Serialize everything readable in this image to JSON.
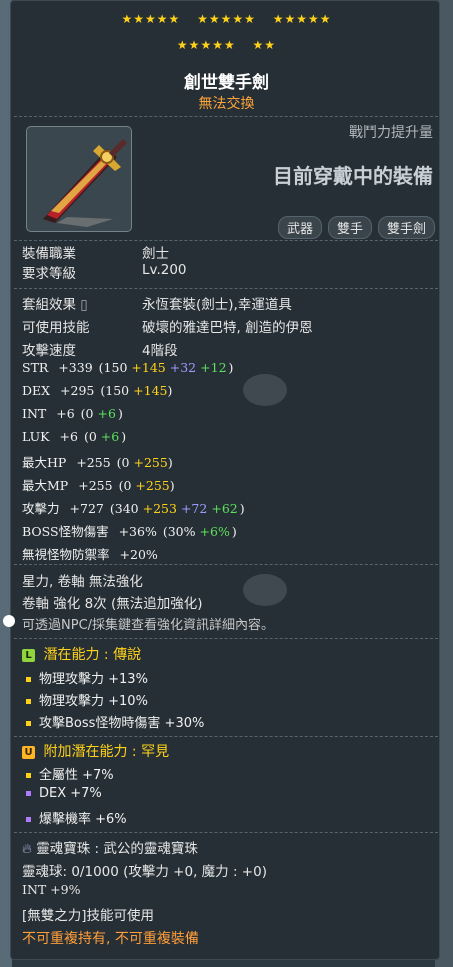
{
  "stars": {
    "row1": [
      "★★★★★",
      "★★★★★",
      "★★★★★"
    ],
    "row2": [
      "★★★★★",
      "★★"
    ]
  },
  "item": {
    "name": "創世雙手劍",
    "trade": "無法交換",
    "power_label": "戰鬥力提升量",
    "wearing_label": "目前穿戴中的裝備",
    "tags": [
      "武器",
      "雙手",
      "雙手劍"
    ]
  },
  "requirements": {
    "job_label": "裝備職業",
    "job_value": "劍士",
    "level_label": "要求等級",
    "level_value": "Lv.200"
  },
  "info": {
    "set_label": "套組效果",
    "set_value": "永恆套裝(劍士),幸運道具",
    "skill_label": "可使用技能",
    "skill_value": "破壞的雅達巴特, 創造的伊恩",
    "speed_label": "攻擊速度",
    "speed_value": "4階段"
  },
  "stats": [
    {
      "name": "STR",
      "total": "+339",
      "open": "(150",
      "star": "+145",
      "flame": "+32",
      "extra": "+12",
      "close": ")"
    },
    {
      "name": "DEX",
      "total": "+295",
      "open": "(150",
      "star": "+145",
      "flame": "",
      "extra": "",
      "close": ")"
    },
    {
      "name": "INT",
      "total": "+6",
      "open": "(0",
      "star": "",
      "flame": "",
      "extra": "+6",
      "close": ")"
    },
    {
      "name": "LUK",
      "total": "+6",
      "open": "(0",
      "star": "",
      "flame": "",
      "extra": "+6",
      "close": ")"
    },
    {
      "name": "最大HP",
      "total": "+255",
      "open": "(0",
      "star": "+255",
      "flame": "",
      "extra": "",
      "close": ")"
    },
    {
      "name": "最大MP",
      "total": "+255",
      "open": "(0",
      "star": "+255",
      "flame": "",
      "extra": "",
      "close": ")"
    },
    {
      "name": "攻擊力",
      "total": "+727",
      "open": "(340",
      "star": "+253",
      "flame": "+72",
      "extra": "+62",
      "close": ")"
    },
    {
      "name": "BOSS怪物傷害",
      "total": "+36%",
      "open": "(30%",
      "star": "",
      "flame": "",
      "extra": "+6%",
      "close": ")"
    },
    {
      "name": "無視怪物防禦率",
      "total": "+20%",
      "open": "",
      "star": "",
      "flame": "",
      "extra": "",
      "close": ""
    }
  ],
  "enhance": {
    "line1": "星力, 卷軸 無法強化",
    "line2": "卷軸 強化 8次 (無法追加強化)",
    "line3": "可透過NPC/採集鍵查看強化資訊詳細內容。"
  },
  "potential": {
    "badge": "L",
    "header": "潛在能力 : 傳說",
    "lines": [
      "物理攻擊力 +13%",
      "物理攻擊力 +10%",
      "攻擊Boss怪物時傷害 +30%"
    ]
  },
  "bonus_potential": {
    "badge": "U",
    "header": "附加潛在能力 : 罕見",
    "lines": [
      "全屬性 +7%",
      "DEX +7%",
      "爆擊機率 +6%"
    ]
  },
  "soul": {
    "line1": "靈魂寶珠 : 武公的靈魂寶珠",
    "line2": "靈魂球: 0/1000 (攻擊力 +0, 魔力 : +0)",
    "line3": "INT +9%",
    "line4": "[無雙之力]技能可使用"
  },
  "warning": "不可重複持有, 不可重複裝備",
  "colors": {
    "star": "#ffd21a",
    "trade": "#ffa43a",
    "flame": "#9b9bff",
    "extra": "#5ce05c",
    "warning": "#ff9d3a"
  }
}
